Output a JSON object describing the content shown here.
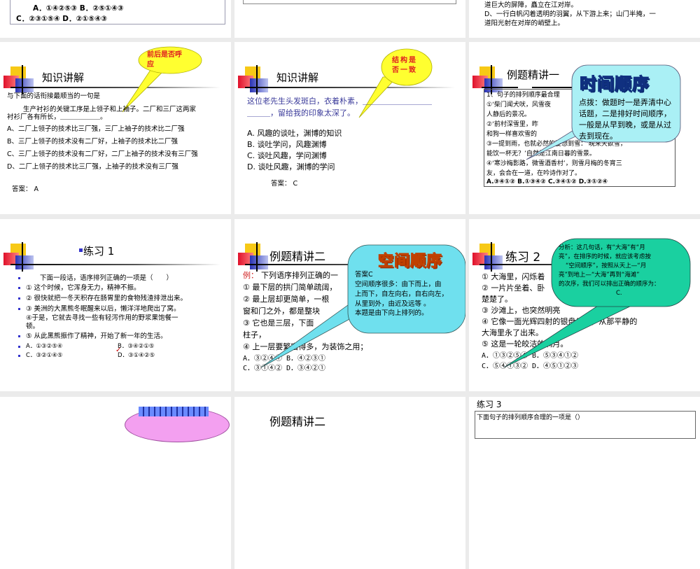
{
  "slides_row0": {
    "left": {
      "options_line1": "A．①④②⑤③  B．②⑤①④③",
      "options_line2": "C．②③①⑤④  D．②①⑤④③"
    },
    "right": {
      "line1": "道巨大的屏障，矗立在江对岸。",
      "line2": "D、一行白帆闪着透明的羽翼，从下游上来；山门半掩，一",
      "line3": "道阳光射在对岸的峭壁上。"
    }
  },
  "slide_knowledge1": {
    "title": "知识讲解",
    "callout": "前后是否呼应",
    "question": "与下面的话衔接最顺当的一句是",
    "passage1": "生产衬衫的关键工序是上领子和上袖子。二厂和三厂这两家",
    "passage2": "衬衫厂各有所长，＿＿＿＿＿＿。",
    "options": [
      "A、二厂上领子的技术比三厂强，三厂上袖子的技术比二厂强",
      "B、三厂上领子的技术没有二厂好，上袖子的技术比二厂强",
      "C、三厂上领子的技术没有二厂好，二厂上袖子的技术没有三厂强",
      "D、二厂上领子的技术比三厂强，上袖子的技术没有三厂强"
    ],
    "answer": "答案： A"
  },
  "slide_knowledge2": {
    "title": "知识讲解",
    "callout": "结构是否一致",
    "question1": "这位老先生头发斑白，衣着朴素，＿＿＿＿＿＿＿＿＿",
    "question2": "＿＿＿，留给我的印象太深了。",
    "options": [
      "A. 风趣的谈吐，渊博的知识",
      "B. 谈吐学问，风趣渊博",
      "C. 谈吐风趣，学问渊博",
      "D. 谈吐风趣，渊博的学问"
    ],
    "answer": "答案： C"
  },
  "slide_example1": {
    "title": "例题精讲一",
    "wordart": "时间顺序",
    "lines": [
      "1、句子的排列顺序最合理",
      "①‘柴门闻犬吠，风雪夜",
      "人静后的景况。",
      "②‘前村深雪里，昨",
      "和狗一样喜欢雪的",
      "③一提到雨，也就必然的要想到雪：‘晚来天欲雪，",
      "能饮一杯无？’自然是江南日暮的雪景。",
      "④‘寒沙梅影路，微雪酒香村’，则雪月梅的冬宵三",
      "友，会合在一道，在吟诗作对了。"
    ],
    "options": "A.③④①②  B.①③④②  C.③④①②  D.③①②④",
    "hint": [
      "点拨：做题时一是弄清中心",
      "话题，二是排好时间顺序，",
      "一般是从早到晚，或是从过",
      "去到现在。"
    ]
  },
  "slide_practice1": {
    "title": "练习 1",
    "items": [
      "下面一段话，语序排列正确的一项是（　　）",
      "① 这个时候，它浑身无力，精神不振。",
      "② 很快就把一冬天积存在肠胃里的食物残渣排泄出来。",
      "③ 美洲的大黑熊冬眠醒来以后，懒洋洋地爬出了窝。",
      "④于是，它就去寻找一些有轻泻作用的野浆果饱餐一",
      "顿。",
      "⑤ 从此黑熊振作了精神，开始了新一年的生活。"
    ],
    "optA": "A．①③②⑤④",
    "optB": "B．③④②①⑤",
    "optC": "C．③②①④⑤",
    "optD": "D．③①④②⑤"
  },
  "slide_example2": {
    "title": "例题精讲二",
    "label": "例：",
    "lines": [
      "下列语序排列正确的一",
      "① 最下层的拱门简单疏阔，",
      "② 最上层却更简单，一根",
      "窗和门之外，都是整块",
      "③ 它也是三层，下面",
      "柱子，",
      "④ 上一层要繁富得多，为装饰之用；"
    ],
    "optAB": "A．③②④①  B．④②③①",
    "optCD": "C．③①④②  D．③④②①",
    "wordart": "空间顺序",
    "callout": [
      "答案C",
      "空间顺序很多：由下而上，由",
      "上而下，自左向右，自右向左，",
      "从里到外，由近及远等 。",
      "本题是由下向上排列的。"
    ]
  },
  "slide_practice2": {
    "title": "练习 2",
    "lines": [
      "① 大海里，闪烁着",
      "② 一片片坐着、卧",
      "楚楚了。",
      "③ 沙滩上，也突然明亮",
      "④ 它像一面光辉四射的银盘似的，从那平静的",
      "大海里永了出来。",
      "⑤ 这是一轮皎洁的满月。"
    ],
    "optAB": "A．①③②⑤④  B．⑤③④①②",
    "optCD": "C．⑤④①③②  D．④⑤①②③",
    "callout": [
      "分析：这几句话，有“大海”有“月",
      "亮”，在排序的时候，就应该考虑按",
      "“空间顺序”，按照从天上—“月",
      "亮”到地上—“大海”再到“海滩”",
      "的次序，我们可以排出正确的顺序为：",
      "C."
    ]
  },
  "slides_row3": {
    "middle_title": "例题精讲二",
    "right_title": "练习 3",
    "right_question": "下面句子的排列顺序合理的一项是（）"
  }
}
